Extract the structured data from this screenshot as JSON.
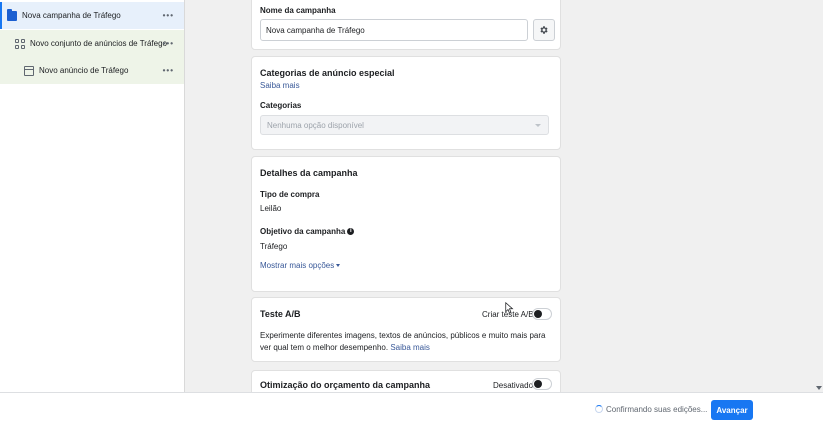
{
  "tree": {
    "campaign": {
      "label": "Nova campanha de Tráfego",
      "more": "•••"
    },
    "adset": {
      "label": "Novo conjunto de anúncios de Tráfego",
      "more": "•••"
    },
    "ad": {
      "label": "Novo anúncio de Tráfego",
      "more": "•••"
    }
  },
  "campaign_name": {
    "label": "Nome da campanha",
    "value": "Nova campanha de Tráfego"
  },
  "special_categories": {
    "title": "Categorias de anúncio especial",
    "learn_more": "Saiba mais",
    "categories_label": "Categorias",
    "select_value": "Nenhuma opção disponível"
  },
  "campaign_details": {
    "title": "Detalhes da campanha",
    "purchase_type_label": "Tipo de compra",
    "purchase_type_value": "Leilão",
    "objective_label": "Objetivo da campanha",
    "objective_value": "Tráfego",
    "show_more": "Mostrar mais opções"
  },
  "ab_test": {
    "title": "Teste A/B",
    "toggle_label": "Criar teste A/B",
    "description": "Experimente diferentes imagens, textos de anúncios, públicos e muito mais para ver qual tem o melhor desempenho.",
    "learn_more": "Saiba mais"
  },
  "budget_optimization": {
    "title": "Otimização do orçamento da campanha",
    "toggle_label": "Desativado"
  },
  "footer": {
    "status": "Confirmando suas edições...",
    "next_button": "Avançar"
  },
  "colors": {
    "accent": "#1877f2",
    "link": "#385898",
    "selected_row": "#e7f0fb",
    "child_rows": "#eef4e8"
  }
}
